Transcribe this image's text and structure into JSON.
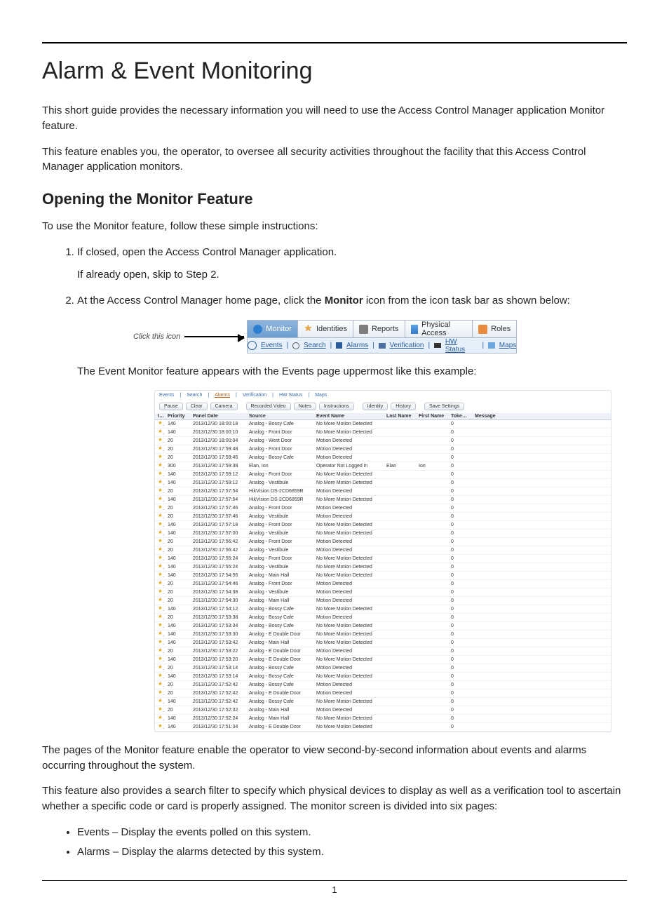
{
  "page": {
    "number": "1"
  },
  "title": "Alarm & Event Monitoring",
  "intro1": "This short guide provides the necessary information you will need to use the Access Control Manager application Monitor feature.",
  "intro2": "This feature enables you, the operator, to oversee all security activities throughout the facility that this Access Control Manager application monitors.",
  "section1": {
    "heading": "Opening the Monitor Feature",
    "lead": "To use the Monitor feature, follow these simple instructions:",
    "step1a": "If closed, open the Access Control Manager application.",
    "step1b": "If already open, skip to Step 2.",
    "step2a": "At the Access Control Manager home page, click the ",
    "step2b": "Monitor",
    "step2c": " icon from the icon task bar as shown below:",
    "click_label": "Click this icon",
    "caption_after_toolbar": "The Event Monitor feature appears with the Events page uppermost like this example:"
  },
  "toolbar": {
    "tabs": [
      {
        "label": "Monitor",
        "icon": "monitor-icon",
        "active": true
      },
      {
        "label": "Identities",
        "icon": "identities-icon",
        "active": false
      },
      {
        "label": "Reports",
        "icon": "reports-icon",
        "active": false
      },
      {
        "label": "Physical Access",
        "icon": "physical-access-icon",
        "active": false
      },
      {
        "label": "Roles",
        "icon": "roles-icon",
        "active": false
      }
    ],
    "subnav": [
      {
        "label": "Events",
        "icon": "clock-icon"
      },
      {
        "label": "Search",
        "icon": "search-icon"
      },
      {
        "label": "Alarms",
        "icon": "alarm-icon"
      },
      {
        "label": "Verification",
        "icon": "verification-icon"
      },
      {
        "label": "HW Status",
        "icon": "hw-status-icon"
      },
      {
        "label": "Maps",
        "icon": "maps-icon"
      }
    ]
  },
  "events_panel": {
    "subnav_labels": [
      "Events",
      "Search",
      "Alarms",
      "Verification",
      "HW Status",
      "Maps"
    ],
    "buttons": [
      "Pause",
      "Clear",
      "Camera",
      "Recorded Video",
      "Notes",
      "Instructions",
      "Identity",
      "History",
      "Save Settings"
    ],
    "columns": [
      "Icons",
      "Priority",
      "Panel Date",
      "Source",
      "Event Name",
      "Last Name",
      "First Name",
      "Token No",
      "Message"
    ],
    "rows": [
      {
        "pri": "140",
        "date": "2013/12/30 18:00:18",
        "src": "Analog - Bossy Cafe",
        "evt": "No More Motion Detected"
      },
      {
        "pri": "140",
        "date": "2013/12/30 18:00:10",
        "src": "Analog - Front Door",
        "evt": "No More Motion Detected"
      },
      {
        "pri": "20",
        "date": "2013/12/30 18:00:04",
        "src": "Analog - West Door",
        "evt": "Motion Detected"
      },
      {
        "pri": "20",
        "date": "2013/12/30 17:59:48",
        "src": "Analog - Front Door",
        "evt": "Motion Detected"
      },
      {
        "pri": "20",
        "date": "2013/12/30 17:59:46",
        "src": "Analog - Bossy Cafe",
        "evt": "Motion Detected"
      },
      {
        "pri": "300",
        "date": "2013/12/30 17:59:38",
        "src": "Elan, Ion",
        "evt": "Operator Not Logged in",
        "ln": "Elan",
        "fn": "Ion"
      },
      {
        "pri": "140",
        "date": "2013/12/30 17:59:12",
        "src": "Analog - Front Door",
        "evt": "No More Motion Detected"
      },
      {
        "pri": "140",
        "date": "2013/12/30 17:59:12",
        "src": "Analog - Vestibule",
        "evt": "No More Motion Detected"
      },
      {
        "pri": "20",
        "date": "2013/12/30 17:57:54",
        "src": "HikVision DS-2CD6859R",
        "evt": "Motion Detected"
      },
      {
        "pri": "140",
        "date": "2013/12/30 17:57:54",
        "src": "HikVision DS-2CD6859R",
        "evt": "No More Motion Detected"
      },
      {
        "pri": "20",
        "date": "2013/12/30 17:57:46",
        "src": "Analog - Front Door",
        "evt": "Motion Detected"
      },
      {
        "pri": "20",
        "date": "2013/12/30 17:57:46",
        "src": "Analog - Vestibule",
        "evt": "Motion Detected"
      },
      {
        "pri": "140",
        "date": "2013/12/30 17:57:18",
        "src": "Analog - Front Door",
        "evt": "No More Motion Detected"
      },
      {
        "pri": "140",
        "date": "2013/12/30 17:57:00",
        "src": "Analog - Vestibule",
        "evt": "No More Motion Detected"
      },
      {
        "pri": "20",
        "date": "2013/12/30 17:56:42",
        "src": "Analog - Front Door",
        "evt": "Motion Detected"
      },
      {
        "pri": "20",
        "date": "2013/12/30 17:56:42",
        "src": "Analog - Vestibule",
        "evt": "Motion Detected"
      },
      {
        "pri": "140",
        "date": "2013/12/30 17:55:24",
        "src": "Analog - Front Door",
        "evt": "No More Motion Detected"
      },
      {
        "pri": "140",
        "date": "2013/12/30 17:55:24",
        "src": "Analog - Vestibule",
        "evt": "No More Motion Detected"
      },
      {
        "pri": "140",
        "date": "2013/12/30 17:54:56",
        "src": "Analog - Main Hall",
        "evt": "No More Motion Detected"
      },
      {
        "pri": "20",
        "date": "2013/12/30 17:54:46",
        "src": "Analog - Front Door",
        "evt": "Motion Detected"
      },
      {
        "pri": "20",
        "date": "2013/12/30 17:54:38",
        "src": "Analog - Vestibule",
        "evt": "Motion Detected"
      },
      {
        "pri": "20",
        "date": "2013/12/30 17:54:30",
        "src": "Analog - Main Hall",
        "evt": "Motion Detected"
      },
      {
        "pri": "140",
        "date": "2013/12/30 17:54:12",
        "src": "Analog - Bossy Cafe",
        "evt": "No More Motion Detected"
      },
      {
        "pri": "20",
        "date": "2013/12/30 17:53:38",
        "src": "Analog - Bossy Cafe",
        "evt": "Motion Detected"
      },
      {
        "pri": "140",
        "date": "2013/12/30 17:53:34",
        "src": "Analog - Bossy Cafe",
        "evt": "No More Motion Detected"
      },
      {
        "pri": "140",
        "date": "2013/12/30 17:53:30",
        "src": "Analog - E Double Door",
        "evt": "No More Motion Detected"
      },
      {
        "pri": "140",
        "date": "2013/12/30 17:53:42",
        "src": "Analog - Main Hall",
        "evt": "No More Motion Detected"
      },
      {
        "pri": "20",
        "date": "2013/12/30 17:53:22",
        "src": "Analog - E Double Door",
        "evt": "Motion Detected"
      },
      {
        "pri": "140",
        "date": "2013/12/30 17:53:20",
        "src": "Analog - E Double Door",
        "evt": "No More Motion Detected"
      },
      {
        "pri": "20",
        "date": "2013/12/30 17:53:14",
        "src": "Analog - Bossy Cafe",
        "evt": "Motion Detected"
      },
      {
        "pri": "140",
        "date": "2013/12/30 17:53:14",
        "src": "Analog - Bossy Cafe",
        "evt": "No More Motion Detected"
      },
      {
        "pri": "20",
        "date": "2013/12/30 17:52:42",
        "src": "Analog - Bossy Cafe",
        "evt": "Motion Detected"
      },
      {
        "pri": "20",
        "date": "2013/12/30 17:52:42",
        "src": "Analog - E Double Door",
        "evt": "Motion Detected"
      },
      {
        "pri": "140",
        "date": "2013/12/30 17:52:42",
        "src": "Analog - Bossy Cafe",
        "evt": "No More Motion Detected"
      },
      {
        "pri": "20",
        "date": "2013/12/30 17:52:32",
        "src": "Analog - Main Hall",
        "evt": "Motion Detected"
      },
      {
        "pri": "140",
        "date": "2013/12/30 17:52:24",
        "src": "Analog - Main Hall",
        "evt": "No More Motion Detected"
      },
      {
        "pri": "140",
        "date": "2013/12/30 17:51:34",
        "src": "Analog - E Double Door",
        "evt": "No More Motion Detected"
      }
    ]
  },
  "closing1": "The pages of the Monitor feature enable the operator to view second-by-second information about events and alarms occurring throughout the system.",
  "closing2": "This feature also provides a search filter to specify which physical devices to display as well as a verification tool to ascertain whether a specific code or card is properly assigned. The monitor screen is divided into six pages:",
  "pages_list": [
    "Events – Display the events polled on this system.",
    "Alarms – Display the alarms detected by this system."
  ]
}
